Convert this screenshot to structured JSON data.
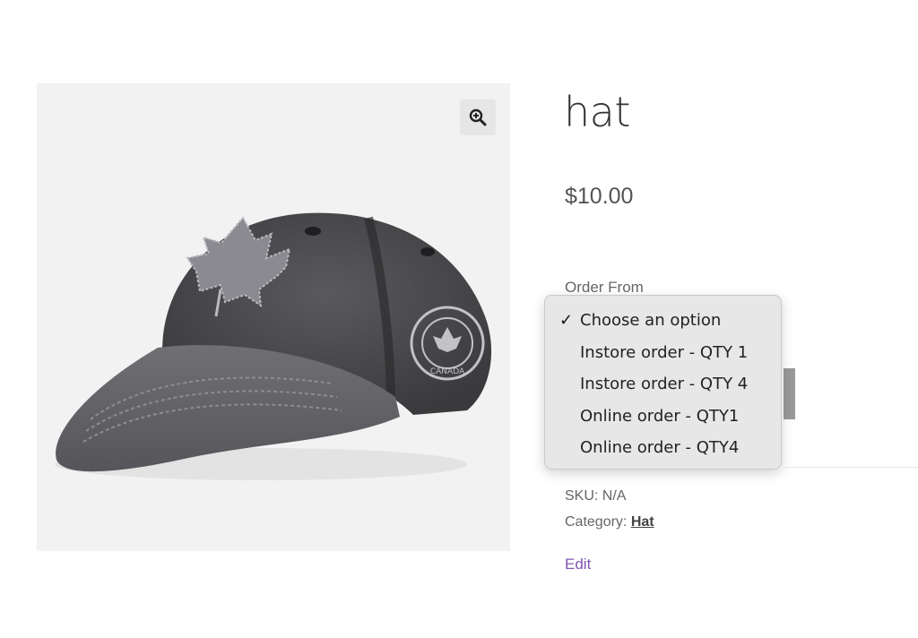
{
  "product": {
    "title": "hat",
    "price": "$10.00",
    "image": {
      "embroidery_text": "CANADA"
    }
  },
  "variation": {
    "label": "Order From",
    "selected": "Choose an option",
    "options": [
      "Choose an option",
      "Instore order - QTY 1",
      "Instore order - QTY 4",
      "Online order - QTY1",
      "Online order - QTY4"
    ],
    "check_mark": "✓"
  },
  "meta": {
    "sku_label": "SKU:",
    "sku_value": "N/A",
    "category_label": "Category:",
    "category_value": "Hat"
  },
  "edit_link": "Edit",
  "icons": {
    "zoom": "zoom-in-icon"
  },
  "colors": {
    "link": "#7f54b3",
    "gallery_bg": "#f2f2f2"
  }
}
